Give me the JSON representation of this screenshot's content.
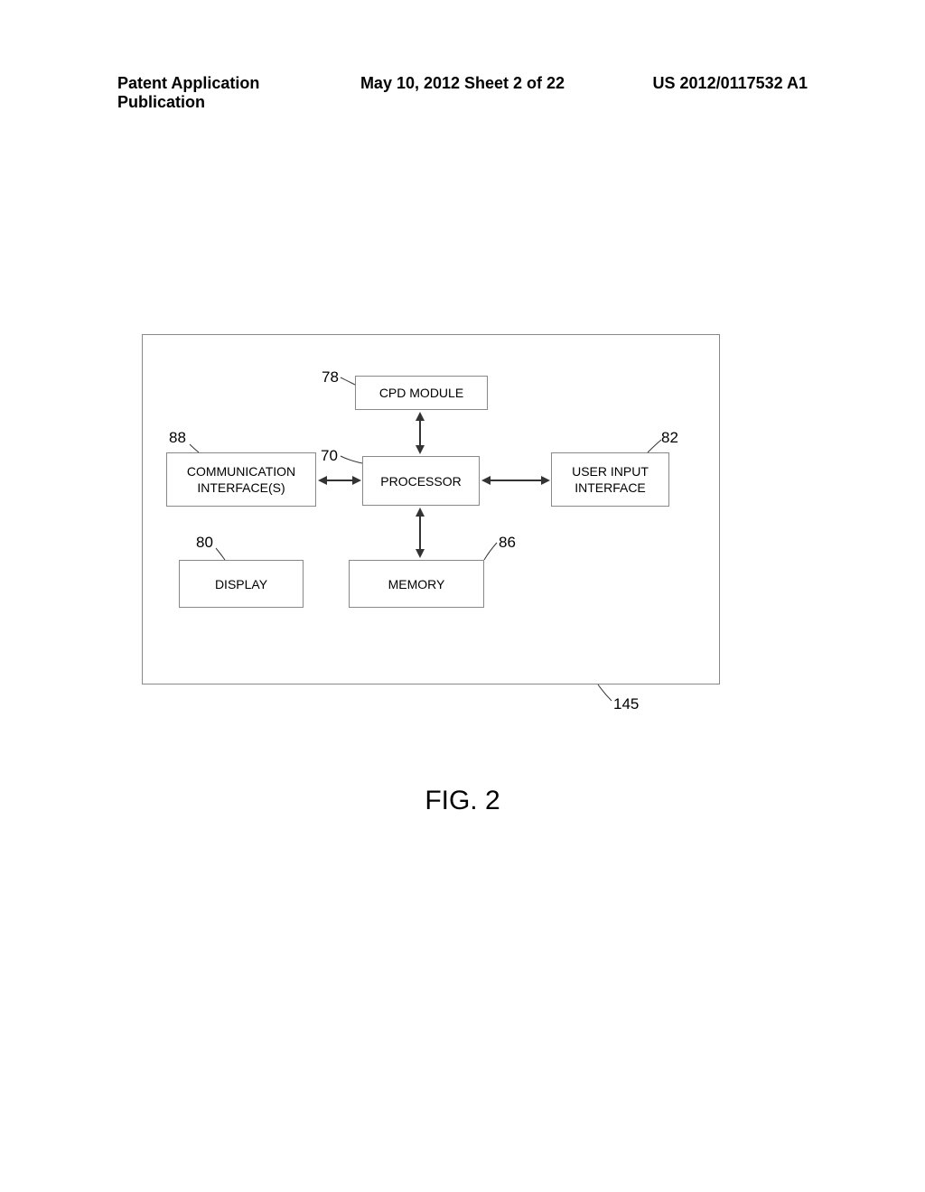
{
  "header": {
    "left": "Patent Application Publication",
    "center": "May 10, 2012  Sheet 2 of 22",
    "right": "US 2012/0117532 A1"
  },
  "blocks": {
    "cpd": "CPD MODULE",
    "processor": "PROCESSOR",
    "comm": "COMMUNICATION INTERFACE(S)",
    "userInput": "USER INPUT INTERFACE",
    "display": "DISPLAY",
    "memory": "MEMORY"
  },
  "refs": {
    "r78": "78",
    "r88": "88",
    "r70": "70",
    "r82": "82",
    "r80": "80",
    "r86": "86",
    "r145": "145"
  },
  "figure": "FIG. 2"
}
